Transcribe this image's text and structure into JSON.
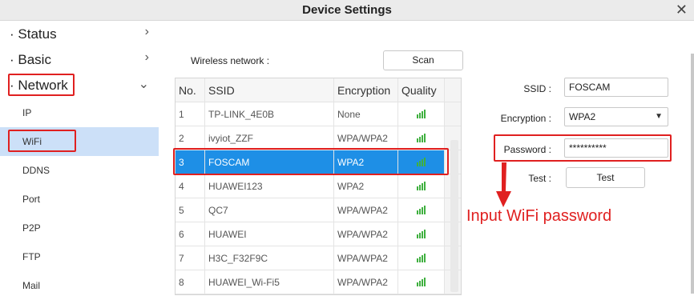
{
  "window": {
    "title": "Device Settings",
    "close_icon": "close-icon"
  },
  "sidebar": {
    "top_items": [
      {
        "label": "· Status",
        "chevron": "›"
      },
      {
        "label": "· Basic",
        "chevron": "›"
      },
      {
        "label": "· Network",
        "chevron": "⌄"
      }
    ],
    "sub_items": [
      "IP",
      "WiFi",
      "DDNS",
      "Port",
      "P2P",
      "FTP",
      "Mail"
    ],
    "active_sub": "WiFi"
  },
  "wifi": {
    "wireless_label": "Wireless network :",
    "scan_label": "Scan",
    "columns": [
      "No.",
      "SSID",
      "Encryption",
      "Quality"
    ],
    "rows": [
      {
        "no": "1",
        "ssid": "TP-LINK_4E0B",
        "enc": "None",
        "quality": 4
      },
      {
        "no": "2",
        "ssid": "ivyiot_ZZF",
        "enc": "WPA/WPA2",
        "quality": 4
      },
      {
        "no": "3",
        "ssid": "FOSCAM",
        "enc": "WPA2",
        "quality": 4
      },
      {
        "no": "4",
        "ssid": "HUAWEI123",
        "enc": "WPA2",
        "quality": 4
      },
      {
        "no": "5",
        "ssid": "QC7",
        "enc": "WPA/WPA2",
        "quality": 4
      },
      {
        "no": "6",
        "ssid": "HUAWEI",
        "enc": "WPA/WPA2",
        "quality": 4
      },
      {
        "no": "7",
        "ssid": "H3C_F32F9C",
        "enc": "WPA/WPA2",
        "quality": 4
      },
      {
        "no": "8",
        "ssid": "HUAWEI_Wi-Fi5",
        "enc": "WPA/WPA2",
        "quality": 4
      }
    ],
    "selected_row": "3",
    "form": {
      "ssid_label": "SSID :",
      "ssid_value": "FOSCAM",
      "encryption_label": "Encryption :",
      "encryption_value": "WPA2",
      "password_label": "Password :",
      "password_value": "**********",
      "test_label": "Test :",
      "test_button": "Test"
    },
    "annotation": "Input WiFi password"
  },
  "colors": {
    "highlight": "#e02020",
    "selected_row": "#1e8fe6",
    "active_nav": "#cce0f8",
    "signal": "#3fb03f"
  }
}
